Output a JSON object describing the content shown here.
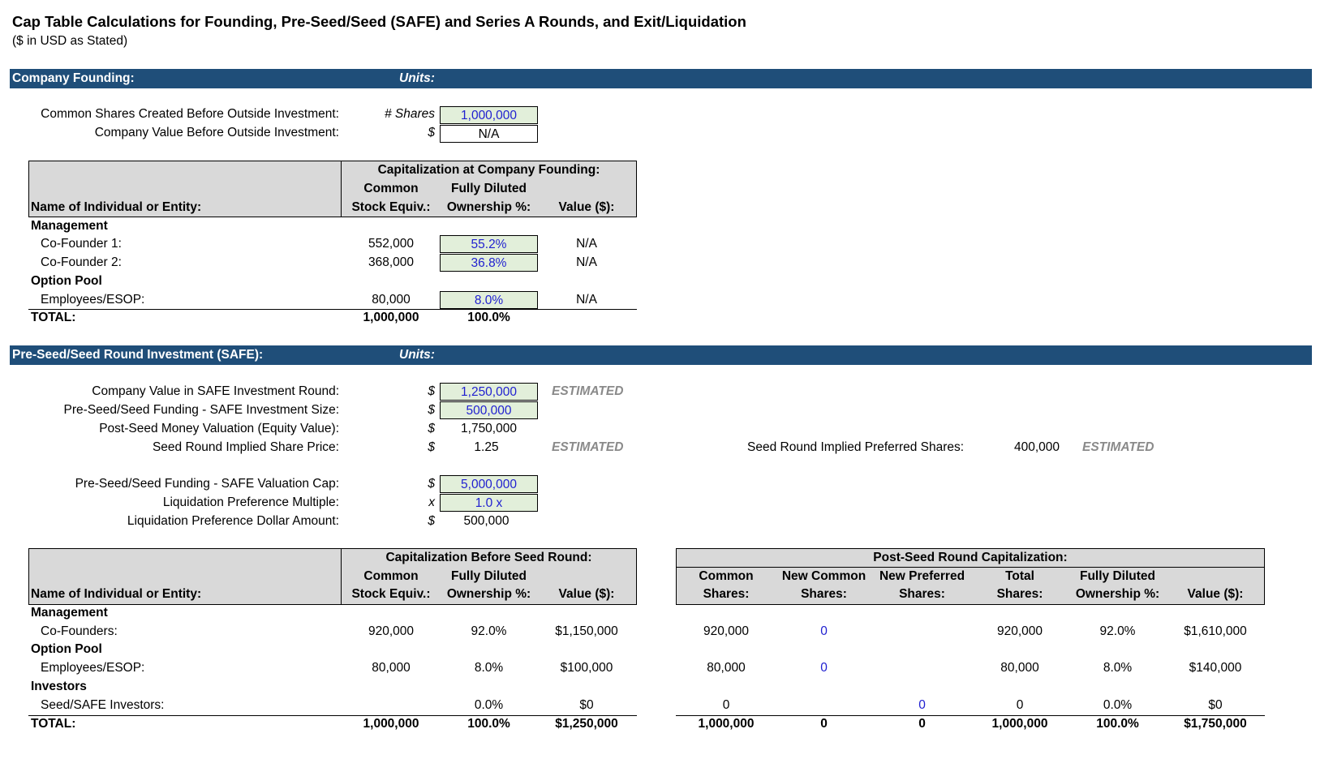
{
  "title": "Cap Table Calculations for Founding, Pre-Seed/Seed (SAFE) and Series A Rounds, and Exit/Liquidation",
  "subtitle": "($ in USD as Stated)",
  "founding": {
    "band_label": "Company Founding:",
    "units_label": "Units:",
    "rows": [
      {
        "label": "Common Shares Created Before Outside Investment:",
        "unit": "# Shares",
        "value": "1,000,000"
      },
      {
        "label": "Company Value Before Outside Investment:",
        "unit": "$",
        "value": "N/A"
      }
    ],
    "table": {
      "group_header": "Capitalization at Company Founding:",
      "name_header": "Name of Individual or Entity:",
      "col1_line1": "Common",
      "col1_line2": "Stock Equiv.:",
      "col2_line1": "Fully Diluted",
      "col2_line2": "Ownership %:",
      "col3": "Value ($):",
      "sections": [
        {
          "header": "Management",
          "rows": [
            {
              "name": "Co-Founder 1:",
              "shares": "552,000",
              "pct": "55.2%",
              "value": "N/A"
            },
            {
              "name": "Co-Founder 2:",
              "shares": "368,000",
              "pct": "36.8%",
              "value": "N/A"
            }
          ]
        },
        {
          "header": "Option Pool",
          "rows": [
            {
              "name": "Employees/ESOP:",
              "shares": "80,000",
              "pct": "8.0%",
              "value": "N/A"
            }
          ]
        }
      ],
      "total": {
        "label": "TOTAL:",
        "shares": "1,000,000",
        "pct": "100.0%"
      }
    }
  },
  "seed": {
    "band_label": "Pre-Seed/Seed Round Investment (SAFE):",
    "units_label": "Units:",
    "rows": [
      {
        "label": "Company Value in SAFE Investment Round:",
        "unit": "$",
        "value": "1,250,000",
        "note": "ESTIMATED"
      },
      {
        "label": "Pre-Seed/Seed Funding - SAFE Investment Size:",
        "unit": "$",
        "value": "500,000"
      },
      {
        "label": "Post-Seed Money Valuation (Equity Value):",
        "unit": "$",
        "value": "1,750,000"
      },
      {
        "label": "Seed Round Implied Share Price:",
        "unit": "$",
        "value": "1.25",
        "note": "ESTIMATED"
      },
      {
        "label": "Pre-Seed/Seed Funding - SAFE Valuation Cap:",
        "unit": "$",
        "value": "5,000,000"
      },
      {
        "label": "Liquidation Preference Multiple:",
        "unit": "x",
        "value": "1.0 x"
      },
      {
        "label": "Liquidation Preference Dollar Amount:",
        "unit": "$",
        "value": "500,000"
      }
    ],
    "implied_pref": {
      "label": "Seed Round Implied Preferred Shares:",
      "value": "400,000",
      "note": "ESTIMATED"
    },
    "before_table": {
      "group_header": "Capitalization Before Seed Round:",
      "name_header": "Name of Individual or Entity:",
      "col1_line1": "Common",
      "col1_line2": "Stock Equiv.:",
      "col2_line1": "Fully Diluted",
      "col2_line2": "Ownership %:",
      "col3": "Value ($):",
      "sections": [
        {
          "header": "Management",
          "rows": [
            {
              "name": "Co-Founders:",
              "shares": "920,000",
              "pct": "92.0%",
              "value": "$1,150,000"
            }
          ]
        },
        {
          "header": "Option Pool",
          "rows": [
            {
              "name": "Employees/ESOP:",
              "shares": "80,000",
              "pct": "8.0%",
              "value": "$100,000"
            }
          ]
        },
        {
          "header": "Investors",
          "rows": [
            {
              "name": "Seed/SAFE Investors:",
              "shares": "",
              "pct": "0.0%",
              "value": "$0"
            }
          ]
        }
      ],
      "total": {
        "label": "TOTAL:",
        "shares": "1,000,000",
        "pct": "100.0%",
        "value": "$1,250,000"
      }
    },
    "post_table": {
      "group_header": "Post-Seed Round Capitalization:",
      "headers": [
        {
          "l1": "Common",
          "l2": "Shares:"
        },
        {
          "l1": "New Common",
          "l2": "Shares:"
        },
        {
          "l1": "New Preferred",
          "l2": "Shares:"
        },
        {
          "l1": "Total",
          "l2": "Shares:"
        },
        {
          "l1": "Fully Diluted",
          "l2": "Ownership %:"
        },
        {
          "l1": "",
          "l2": "Value ($):"
        }
      ],
      "rows": [
        [
          "920,000",
          "0",
          "",
          "920,000",
          "92.0%",
          "$1,610,000"
        ],
        [
          "80,000",
          "0",
          "",
          "80,000",
          "8.0%",
          "$140,000"
        ],
        [
          "0",
          "",
          "0",
          "0",
          "0.0%",
          "$0"
        ]
      ],
      "total": [
        "1,000,000",
        "0",
        "0",
        "1,000,000",
        "100.0%",
        "$1,750,000"
      ]
    }
  }
}
